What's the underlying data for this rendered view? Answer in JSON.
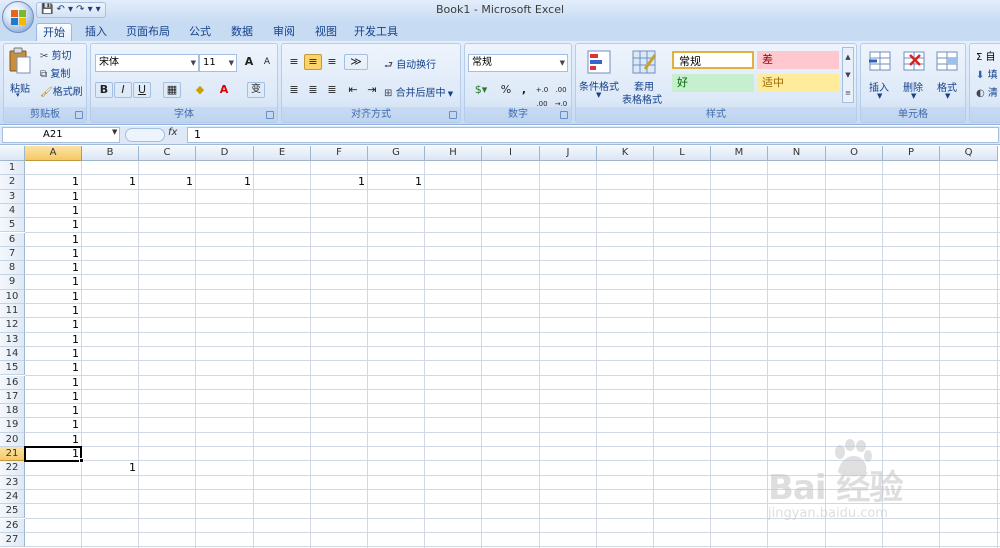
{
  "window": {
    "title": "Book1 - Microsoft Excel"
  },
  "qat": {
    "save": "💾",
    "undo": "↶ ▾",
    "redo": "↷ ▾",
    "customize": "▾"
  },
  "tabs": [
    "开始",
    "插入",
    "页面布局",
    "公式",
    "数据",
    "审阅",
    "视图",
    "开发工具"
  ],
  "active_tab": "开始",
  "ribbon": {
    "clipboard": {
      "label": "剪贴板",
      "paste": "粘贴",
      "cut": "剪切",
      "copy": "复制",
      "format_painter": "格式刷"
    },
    "font": {
      "label": "字体",
      "font_name": "宋体",
      "font_size": "11",
      "bold": "B",
      "italic": "I",
      "underline": "U",
      "grow": "A",
      "shrink": "A",
      "phonetic": "变"
    },
    "alignment": {
      "label": "对齐方式",
      "wrap_text": "自动换行",
      "merge_center": "合并后居中"
    },
    "number": {
      "label": "数字",
      "format": "常规",
      "percent": "%",
      "comma": ",",
      "inc_decimal": "+.0 .00",
      "dec_decimal": ".00 →.0"
    },
    "styles": {
      "label": "样式",
      "conditional_formatting": "条件格式",
      "format_as_table_1": "套用",
      "format_as_table_2": "表格格式",
      "cell_styles": [
        {
          "name": "常规",
          "bg": "#ffffff",
          "fg": "#000000"
        },
        {
          "name": "差",
          "bg": "#ffc7ce",
          "fg": "#9c0006"
        },
        {
          "name": "好",
          "bg": "#c6efce",
          "fg": "#006100"
        },
        {
          "name": "适中",
          "bg": "#ffeb9c",
          "fg": "#9c6500"
        }
      ]
    },
    "cells": {
      "label": "单元格",
      "insert": "插入",
      "delete": "删除",
      "format": "格式"
    },
    "editing": {
      "sum": "Σ 自",
      "fill": "填",
      "clear": "清"
    }
  },
  "formula_bar": {
    "name_box": "A21",
    "fx": "fx",
    "content": "1"
  },
  "columns": [
    "A",
    "B",
    "C",
    "D",
    "E",
    "F",
    "G",
    "H",
    "I",
    "J",
    "K",
    "L",
    "M",
    "N",
    "O",
    "P",
    "Q"
  ],
  "rows": [
    "1",
    "2",
    "3",
    "4",
    "5",
    "6",
    "7",
    "8",
    "9",
    "10",
    "11",
    "12",
    "13",
    "14",
    "15",
    "16",
    "17",
    "18",
    "19",
    "20",
    "21",
    "22",
    "23",
    "24",
    "25",
    "26",
    "27"
  ],
  "selected": {
    "row": 21,
    "col": "A"
  },
  "cells": [
    {
      "row": 2,
      "col": "A",
      "value": "1"
    },
    {
      "row": 2,
      "col": "B",
      "value": "1"
    },
    {
      "row": 2,
      "col": "C",
      "value": "1"
    },
    {
      "row": 2,
      "col": "D",
      "value": "1"
    },
    {
      "row": 2,
      "col": "F",
      "value": "1"
    },
    {
      "row": 2,
      "col": "G",
      "value": "1"
    },
    {
      "row": 3,
      "col": "A",
      "value": "1"
    },
    {
      "row": 4,
      "col": "A",
      "value": "1"
    },
    {
      "row": 5,
      "col": "A",
      "value": "1"
    },
    {
      "row": 6,
      "col": "A",
      "value": "1"
    },
    {
      "row": 7,
      "col": "A",
      "value": "1"
    },
    {
      "row": 8,
      "col": "A",
      "value": "1"
    },
    {
      "row": 9,
      "col": "A",
      "value": "1"
    },
    {
      "row": 10,
      "col": "A",
      "value": "1"
    },
    {
      "row": 11,
      "col": "A",
      "value": "1"
    },
    {
      "row": 12,
      "col": "A",
      "value": "1"
    },
    {
      "row": 13,
      "col": "A",
      "value": "1"
    },
    {
      "row": 14,
      "col": "A",
      "value": "1"
    },
    {
      "row": 15,
      "col": "A",
      "value": "1"
    },
    {
      "row": 16,
      "col": "A",
      "value": "1"
    },
    {
      "row": 17,
      "col": "A",
      "value": "1"
    },
    {
      "row": 18,
      "col": "A",
      "value": "1"
    },
    {
      "row": 19,
      "col": "A",
      "value": "1"
    },
    {
      "row": 20,
      "col": "A",
      "value": "1"
    },
    {
      "row": 21,
      "col": "A",
      "value": "1"
    },
    {
      "row": 22,
      "col": "B",
      "value": "1"
    }
  ],
  "watermark": {
    "brand": "Bai 经验",
    "url": "jingyan.baidu.com"
  }
}
